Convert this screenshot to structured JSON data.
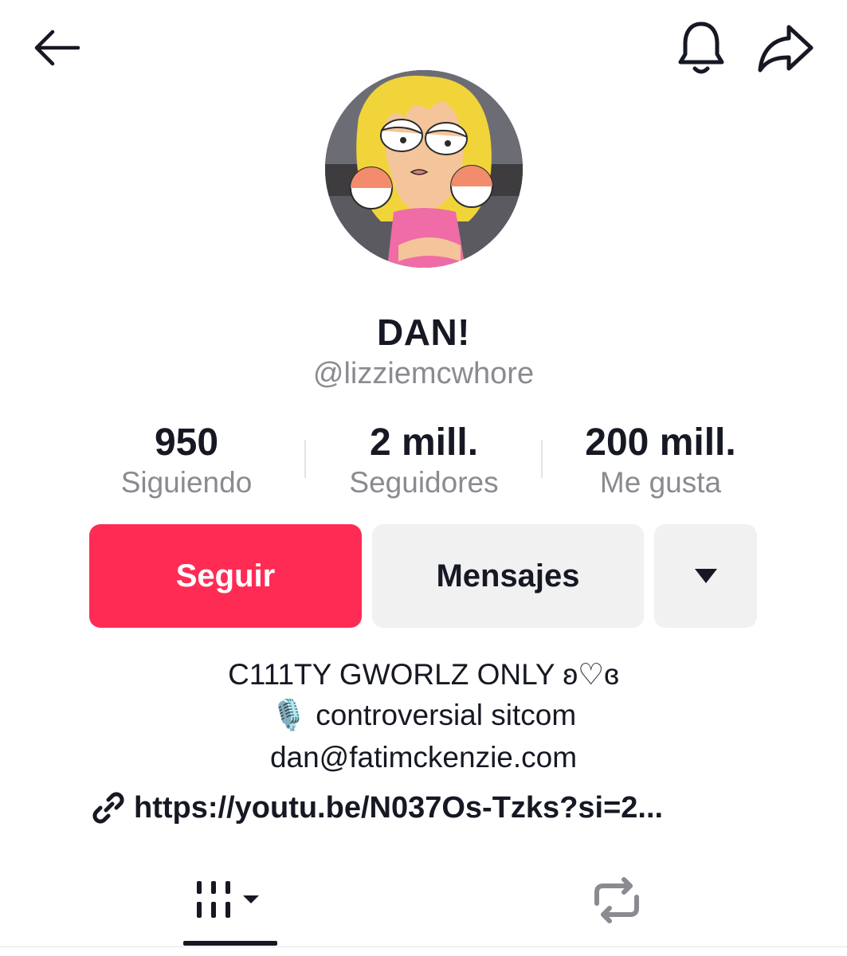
{
  "header": {
    "back_icon": "arrow-left-icon",
    "bell_icon": "bell-icon",
    "share_icon": "share-arrow-icon"
  },
  "profile": {
    "display_name": "DAN!",
    "username": "@lizziemcwhore",
    "avatar_icon": "cartoon-avatar"
  },
  "stats": [
    {
      "value": "950",
      "label": "Siguiendo"
    },
    {
      "value": "2 mill.",
      "label": "Seguidores"
    },
    {
      "value": "200 mill.",
      "label": "Me gusta"
    }
  ],
  "actions": {
    "follow_label": "Seguir",
    "message_label": "Mensajes",
    "more_icon": "caret-down-icon"
  },
  "bio": {
    "line1": "C111TY GWORLZ ONLY ʚ♡ɞ",
    "line2": "🎙️ controversial sitcom",
    "line3": "dan@fatimckenzie.com",
    "link": "https://youtu.be/N037Os-Tzks?si=2..."
  },
  "tabs": {
    "videos_icon": "videos-grid-icon",
    "reposts_icon": "repost-icon",
    "active": "videos"
  },
  "colors": {
    "accent": "#fe2c55",
    "text_primary": "#161823",
    "text_secondary": "#8a8b91",
    "button_secondary": "#f1f1f2"
  }
}
